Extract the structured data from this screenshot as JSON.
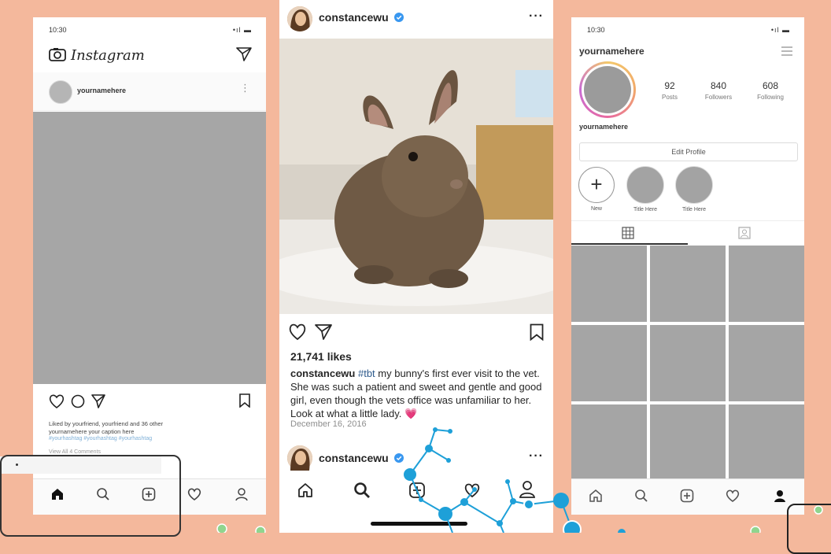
{
  "left_phone": {
    "status_time": "10:30",
    "signal": "•ıl ▬",
    "brand": "Instagram",
    "username": "yournamehere",
    "caption_line1": "Liked by yourfriend, yourfriend and 36 other",
    "caption_line2": "yournamehere your caption here",
    "hashtags": "#yourhashtag #yourhashtag #yourhashtag",
    "view_all": "View All 4 Comments"
  },
  "middle_phone": {
    "username": "constancewu",
    "more": "···",
    "likes": "21,741 likes",
    "caption_user": "constancewu",
    "caption_tag": "#tbt",
    "caption_text": " my bunny's first ever visit to the vet. She was such a patient and sweet and gentle and good girl, even though the vets office was unfamiliar to her. Look at what a little lady.",
    "caption_emoji": "💗",
    "date": "December 16, 2016",
    "next_username": "constancewu",
    "verified_color": "#3897f0"
  },
  "right_phone": {
    "status_time": "10:30",
    "signal": "•ıl ▬",
    "username_header": "yournamehere",
    "posts_count": "92",
    "posts_label": "Posts",
    "followers_count": "840",
    "followers_label": "Followers",
    "following_count": "608",
    "following_label": "Following",
    "profile_name": "yournamehere",
    "edit_profile": "Edit Profile",
    "highlight_new": "New",
    "highlight_1": "Title Here",
    "highlight_2": "Title Here"
  },
  "colors": {
    "background": "#f4b89c",
    "network_accent": "#1ea0d8",
    "placeholder_gray": "#a6a6a6"
  }
}
